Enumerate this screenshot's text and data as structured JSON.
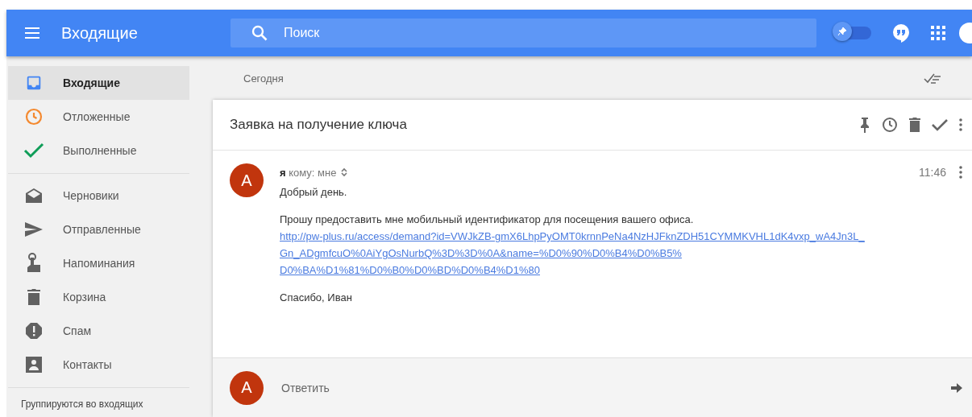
{
  "header": {
    "title": "Входящие",
    "search": {
      "placeholder": "Поиск"
    },
    "pin_toggle": {
      "on": false
    }
  },
  "sidebar": {
    "groups": [
      [
        {
          "label": "Входящие",
          "selected": true
        },
        {
          "label": "Отложенные",
          "selected": false
        },
        {
          "label": "Выполненные",
          "selected": false
        }
      ],
      [
        {
          "label": "Черновики",
          "selected": false
        },
        {
          "label": "Отправленные",
          "selected": false
        },
        {
          "label": "Напоминания",
          "selected": false
        },
        {
          "label": "Корзина",
          "selected": false
        },
        {
          "label": "Спам",
          "selected": false
        },
        {
          "label": "Контакты",
          "selected": false
        }
      ]
    ],
    "footer": "Группируются во входящих"
  },
  "section_label": "Сегодня",
  "thread": {
    "subject": "Заявка на получение ключа",
    "message": {
      "avatar": "A",
      "sender": "я",
      "recipient": "кому: мне",
      "time": "11:46",
      "greeting": "Добрый день.",
      "body": "Прошу предоставить мне мобильный идентификатор для посещения вашего офиса.",
      "link_lines": [
        "http://pw-plus.ru/access/demand?id=VWJkZB-gmX6LhpPyOMT0krnnPeNa4NzHJFknZDH51CYMMKVHL1dK4vxp_wA4Jn3L_",
        "Gn_ADgmfcuO%0AiYgOsNurbQ%3D%3D%0A&name=%D0%90%D0%B4%D0%B5%",
        "D0%BA%D1%81%D0%B0%D0%BD%D0%B4%D1%80"
      ],
      "signature": "Спасибо, Иван"
    },
    "reply": {
      "avatar": "A",
      "placeholder": "Ответить"
    }
  }
}
